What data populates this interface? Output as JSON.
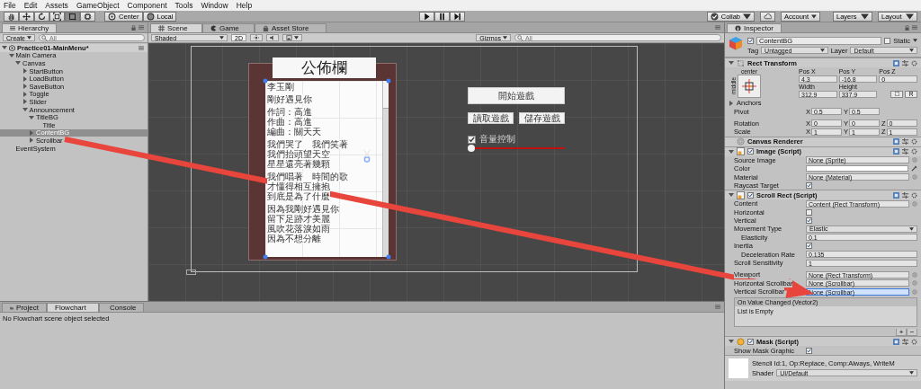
{
  "menu_bar": [
    "File",
    "Edit",
    "Assets",
    "GameObject",
    "Component",
    "Tools",
    "Window",
    "Help"
  ],
  "toolbar": {
    "tools": [
      {
        "kind": "hand",
        "selected": false
      },
      {
        "kind": "move",
        "selected": false
      },
      {
        "kind": "rotate",
        "selected": false
      },
      {
        "kind": "scale",
        "selected": false
      },
      {
        "kind": "rect",
        "selected": true
      },
      {
        "kind": "transform",
        "selected": false
      }
    ],
    "pivot_mode": "Center",
    "pivot_rotation": "Local",
    "play_controls": [
      {
        "kind": "play"
      },
      {
        "kind": "pause"
      },
      {
        "kind": "step"
      }
    ],
    "collab": "Collab",
    "account": "Account",
    "layers": "Layers",
    "layout": "Layout"
  },
  "hierarchy": {
    "title": "Hierarchy",
    "create": "Create",
    "search_placeholder": "All",
    "items": [
      {
        "name": "Practice01-MainMenu*",
        "kind": "scene",
        "expanded": true,
        "selected": false,
        "children": [
          {
            "name": "Main Camera",
            "kind": "group",
            "expanded": true,
            "selected": false,
            "children": [
              {
                "name": "Canvas",
                "kind": "group",
                "expanded": true,
                "selected": false,
                "children": [
                  {
                    "name": "StartButton",
                    "kind": "group",
                    "expanded": false,
                    "selected": false
                  },
                  {
                    "name": "LoadButton",
                    "kind": "group",
                    "expanded": false,
                    "selected": false
                  },
                  {
                    "name": "SaveButton",
                    "kind": "group",
                    "expanded": false,
                    "selected": false
                  },
                  {
                    "name": "Toggle",
                    "kind": "group",
                    "expanded": false,
                    "selected": false
                  },
                  {
                    "name": "Slider",
                    "kind": "group",
                    "expanded": false,
                    "selected": false
                  },
                  {
                    "name": "Announcement",
                    "kind": "group",
                    "expanded": true,
                    "selected": false,
                    "children": [
                      {
                        "name": "TitleBG",
                        "kind": "group",
                        "expanded": true,
                        "selected": false,
                        "children": [
                          {
                            "name": "Title",
                            "kind": "leaf",
                            "selected": false
                          }
                        ]
                      },
                      {
                        "name": "ContentBG",
                        "kind": "group",
                        "expanded": false,
                        "selected": true
                      },
                      {
                        "name": "Scrollbar",
                        "kind": "group",
                        "expanded": false,
                        "selected": false
                      }
                    ]
                  }
                ]
              }
            ]
          },
          {
            "name": "EventSystem",
            "kind": "leaf",
            "selected": false
          }
        ]
      }
    ]
  },
  "scene_view": {
    "tabs": [
      {
        "label": "Scene",
        "kind": "scene",
        "selected": true
      },
      {
        "label": "Game",
        "kind": "game",
        "selected": false
      },
      {
        "label": "Asset Store",
        "kind": "store",
        "selected": false
      }
    ],
    "shading": "Shaded",
    "mode_2d": {
      "label": "2D",
      "on": true
    },
    "gizmos": "Gizmos",
    "search_placeholder": "All",
    "game_ui": {
      "title": "公佈欄",
      "paragraphs": [
        [
          "李玉剛"
        ],
        [
          "剛好遇見你"
        ],
        [
          "作詞：高進",
          "作曲：高進",
          "編曲：關天天"
        ],
        [
          "我們哭了　我們笑著",
          "我們抬頭望天空",
          "星星還亮著幾顆"
        ],
        [
          "我們唱著　時間的歌",
          "才懂得相互擁抱",
          "到底是為了什麼"
        ],
        [
          "因為我剛好遇見你",
          "留下足跡才美麗",
          "風吹花落淚如雨",
          "因為不想分離"
        ]
      ],
      "start_button": "開始遊戲",
      "load_button": "讀取遊戲",
      "save_button": "儲存遊戲",
      "toggle": {
        "label": "音量控制",
        "checked": true
      },
      "slider": {
        "level": 0
      }
    }
  },
  "bottom_panel": {
    "tabs": [
      {
        "label": "Project",
        "kind": "project",
        "selected": false
      },
      {
        "label": "Flowchart",
        "kind": "flowchart",
        "selected": true
      },
      {
        "label": "Console",
        "kind": "console",
        "selected": false
      }
    ],
    "message": "No Flowchart scene object selected"
  },
  "inspector": {
    "title": "Inspector",
    "object": {
      "active": true,
      "name": "ContentBG",
      "static": {
        "label": "Static",
        "checked": false
      },
      "tag_label": "Tag",
      "tag": "Untagged",
      "layer_label": "Layer",
      "layer": "Default"
    },
    "components": [
      {
        "kind": "rect_transform",
        "title": "Rect Transform",
        "expanded": true,
        "anchor_h": "center",
        "anchor_v": "middle",
        "fields": [
          {
            "label": "Pos X",
            "value": "4.3"
          },
          {
            "label": "Pos Y",
            "value": "-16.8"
          },
          {
            "label": "Pos Z",
            "value": "0"
          },
          {
            "label": "Width",
            "value": "312.9"
          },
          {
            "label": "Height",
            "value": "337.9"
          }
        ],
        "reset_label": "R",
        "anchors": {
          "label": "Anchors",
          "expanded": false
        },
        "vectors": [
          {
            "label": "Pivot",
            "values": [
              {
                "axis": "X",
                "value": "0.5"
              },
              {
                "axis": "Y",
                "value": "0.5"
              }
            ]
          },
          {
            "label": "Rotation",
            "values": [
              {
                "axis": "X",
                "value": "0"
              },
              {
                "axis": "Y",
                "value": "0"
              },
              {
                "axis": "Z",
                "value": "0"
              }
            ]
          },
          {
            "label": "Scale",
            "values": [
              {
                "axis": "X",
                "value": "1"
              },
              {
                "axis": "Y",
                "value": "1"
              },
              {
                "axis": "Z",
                "value": "1"
              }
            ]
          }
        ]
      },
      {
        "kind": "canvas_renderer",
        "title": "Canvas Renderer"
      },
      {
        "kind": "image",
        "title": "Image (Script)",
        "expanded": true,
        "enabled": true,
        "groups": [
          [
            {
              "kind": "object",
              "label": "Source Image",
              "value": "None (Sprite)",
              "selected": false
            },
            {
              "kind": "color",
              "label": "Color",
              "color": "#ffffff"
            },
            {
              "kind": "object",
              "label": "Material",
              "value": "None (Material)",
              "selected": false
            },
            {
              "kind": "checkbox",
              "label": "Raycast Target",
              "checked": true
            }
          ]
        ]
      },
      {
        "kind": "scroll_rect",
        "title": "Scroll Rect (Script)",
        "expanded": true,
        "enabled": true,
        "groups": [
          [
            {
              "kind": "object",
              "label": "Content",
              "value": "Content (Rect Transform)",
              "selected": false
            },
            {
              "kind": "checkbox",
              "label": "Horizontal",
              "checked": false
            },
            {
              "kind": "checkbox",
              "label": "Vertical",
              "checked": true
            },
            {
              "kind": "dropdown",
              "label": "Movement Type",
              "value": "Elastic",
              "children": [
                {
                  "kind": "number",
                  "label": "Elasticity",
                  "value": "0.1"
                }
              ]
            },
            {
              "kind": "checkbox",
              "label": "Inertia",
              "checked": true,
              "children": [
                {
                  "kind": "number",
                  "label": "Deceleration Rate",
                  "value": "0.135"
                }
              ]
            },
            {
              "kind": "number",
              "label": "Scroll Sensitivity",
              "value": "1"
            }
          ],
          [
            {
              "kind": "object",
              "label": "Viewport",
              "value": "None (Rect Transform)",
              "selected": false
            },
            {
              "kind": "object",
              "label": "Horizontal Scrollbar",
              "value": "None (Scrollbar)",
              "selected": false
            },
            {
              "kind": "object",
              "label": "Vertical Scrollbar",
              "value": "None (Scrollbar)",
              "selected": true
            }
          ]
        ],
        "event": {
          "title": "On Value Changed (Vector2)",
          "body": "List is Empty",
          "add": "+",
          "remove": "−"
        }
      },
      {
        "kind": "mask",
        "title": "Mask (Script)",
        "expanded": true,
        "enabled": true,
        "groups": [
          [
            {
              "kind": "checkbox",
              "label": "Show Mask Graphic",
              "checked": true
            }
          ]
        ]
      }
    ],
    "material": {
      "summary": "Stencil Id:1, Op:Replace, Comp:Always, WriteM",
      "shader_label": "Shader",
      "shader": "UI/Default"
    }
  }
}
